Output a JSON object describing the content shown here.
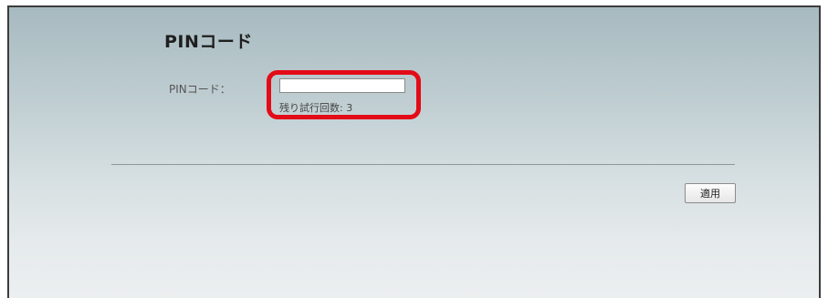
{
  "page": {
    "title": "PINコード"
  },
  "form": {
    "pin_label": "PINコード：",
    "pin_value": "",
    "remaining_attempts": "残り試行回数: 3",
    "highlight_color": "#e30b17"
  },
  "actions": {
    "apply_label": "適用"
  }
}
